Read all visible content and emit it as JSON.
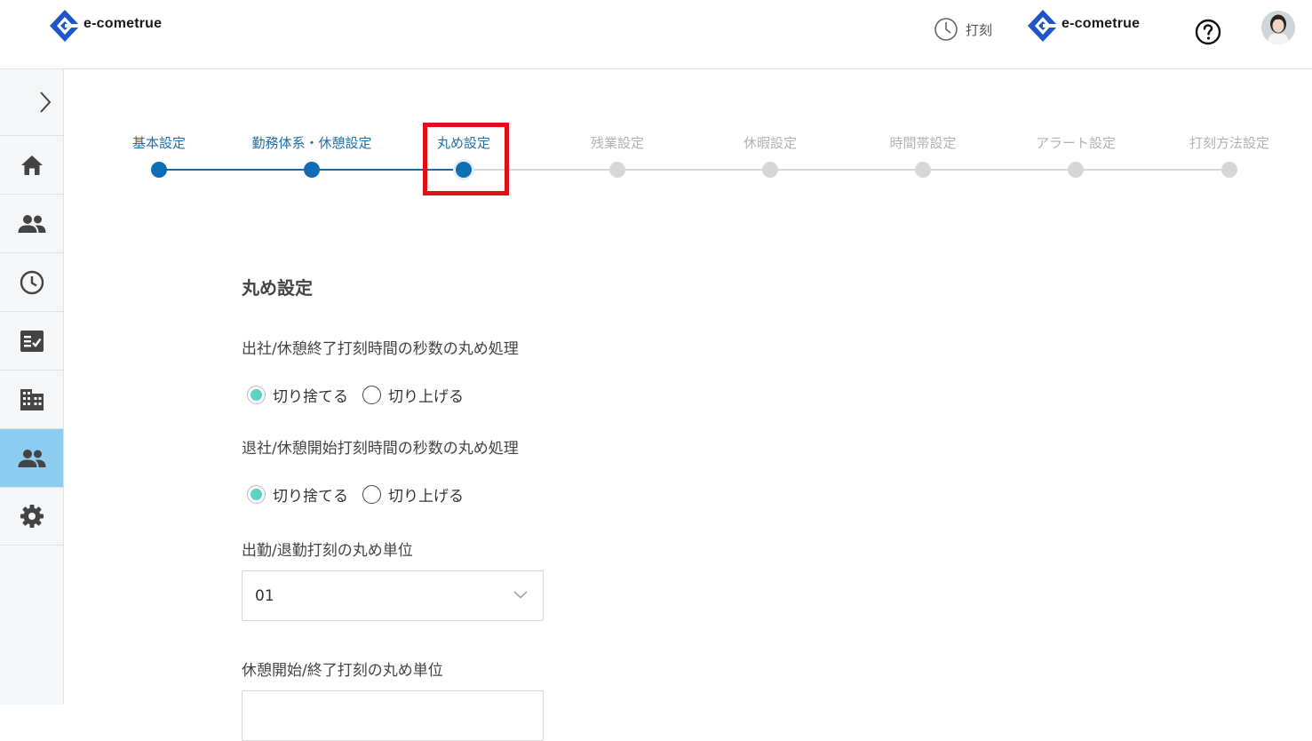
{
  "header": {
    "brand_name": "e-cometrue",
    "punch_label": "打刻",
    "help_icon": "question-circle-icon",
    "clock_icon": "clock-icon"
  },
  "sidebar": {
    "items": [
      {
        "icon": "home-icon"
      },
      {
        "icon": "people-icon"
      },
      {
        "icon": "clock-icon"
      },
      {
        "icon": "checklist-icon"
      },
      {
        "icon": "building-icon"
      },
      {
        "icon": "people-icon",
        "active": true
      },
      {
        "icon": "gear-icon"
      }
    ]
  },
  "stepper": {
    "steps": [
      {
        "label": "基本設定",
        "state": "done"
      },
      {
        "label": "勤務体系・休憩設定",
        "state": "done"
      },
      {
        "label": "丸め設定",
        "state": "current"
      },
      {
        "label": "残業設定",
        "state": "todo"
      },
      {
        "label": "休暇設定",
        "state": "todo"
      },
      {
        "label": "時間帯設定",
        "state": "todo"
      },
      {
        "label": "アラート設定",
        "state": "todo"
      },
      {
        "label": "打刻方法設定",
        "state": "todo"
      }
    ]
  },
  "form": {
    "title": "丸め設定",
    "q1": {
      "label": "出社/休憩終了打刻時間の秒数の丸め処理",
      "opt1": "切り捨てる",
      "opt2": "切り上げる",
      "selected": "切り捨てる"
    },
    "q2": {
      "label": "退社/休憩開始打刻時間の秒数の丸め処理",
      "opt1": "切り捨てる",
      "opt2": "切り上げる",
      "selected": "切り捨てる"
    },
    "q3": {
      "label": "出勤/退勤打刻の丸め単位",
      "value": "01"
    },
    "q4": {
      "label": "休憩開始/終了打刻の丸め単位",
      "value": ""
    }
  },
  "colors": {
    "accent": "#0d6eb5",
    "sidebar_active": "#8ecdf2",
    "radio_checked": "#5ed3c4",
    "highlight": "#e0101b"
  }
}
